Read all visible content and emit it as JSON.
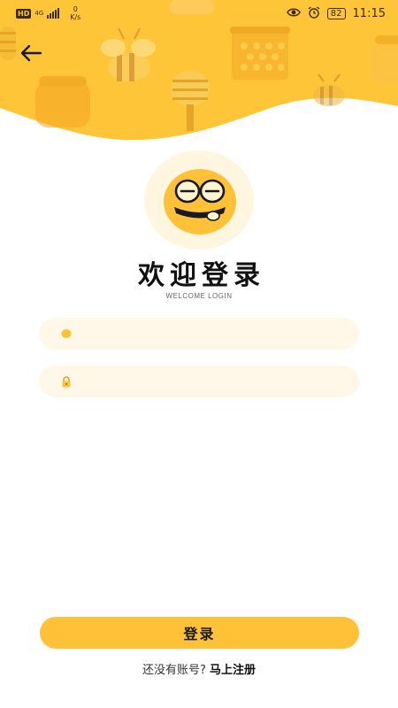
{
  "status_bar": {
    "hd_badge": "HD",
    "network_type": "4G",
    "speed_value": "0",
    "speed_unit": "K/s",
    "battery": "82",
    "time": "11:15",
    "icons": [
      "eye-icon",
      "alarm-icon",
      "battery-icon"
    ]
  },
  "header": {
    "back_icon": "arrow-left-icon",
    "theme_color": "#ffc538"
  },
  "welcome": {
    "title": "欢迎登录",
    "subtitle": "WELCOME LOGIN"
  },
  "form": {
    "username": {
      "value": "",
      "placeholder": "",
      "icon": "user-icon"
    },
    "password": {
      "value": "",
      "placeholder": "",
      "icon": "lock-icon"
    }
  },
  "actions": {
    "login_label": "登录",
    "register_prompt": "还没有账号?",
    "register_link": "马上注册"
  },
  "colors": {
    "primary": "#ffc137",
    "input_bg": "#fff8e9",
    "text": "#111111"
  }
}
